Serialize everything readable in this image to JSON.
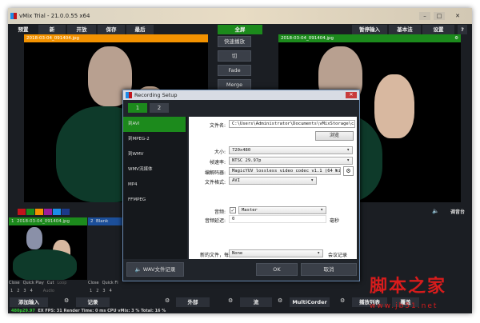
{
  "window": {
    "title": "vMix Trial - 21.0.0.55 x64",
    "min": "–",
    "max": "□",
    "close": "✕"
  },
  "menu": {
    "presets": "预置",
    "new": "新",
    "open": "开放",
    "save": "保存",
    "last": "最后",
    "fullscreen": "全屏",
    "add_input_stream": "暂停输入",
    "basic": "基本法",
    "settings": "设置",
    "help": "?"
  },
  "preview": {
    "title": "2018-03-04_091404.jpg"
  },
  "output": {
    "title": "2018-03-04_091404.jpg"
  },
  "transitions": {
    "quick_play": "快速播放",
    "cut": "切",
    "fade": "Fade",
    "merge": "Merge"
  },
  "colors": {
    "accent_green": "#1c8a1c",
    "preview_orange": "#f39200",
    "input_blue": "#1c4f9a",
    "tags": [
      "#c0141c",
      "#1c8a1c",
      "#f39200",
      "#9b1c9b",
      "#1c8ce8",
      "#1c3a8a"
    ]
  },
  "inputs": [
    {
      "number": "1",
      "name": "2018-03-04_091404.jpg",
      "controls": [
        "Close",
        "Quick Play",
        "Cut",
        "Loop"
      ],
      "numbers": [
        "1",
        "2",
        "3",
        "4"
      ],
      "audio": "Audio"
    },
    {
      "number": "2",
      "name": "Blank",
      "controls": [
        "Close",
        "Quick Fl"
      ],
      "numbers": [
        "1",
        "2",
        "3",
        "4"
      ],
      "audio": "Audio"
    }
  ],
  "mixer_label": "调音台",
  "dialog": {
    "title": "Recording Setup",
    "tabs": [
      "1",
      "2"
    ],
    "formats": [
      "到AVI",
      "到MPEG-2",
      "到WMV",
      "WMV流媒体",
      "MP4",
      "FFMPEG"
    ],
    "filename_label": "文件名:",
    "filename": "C:\\Users\\Administrator\\Documents\\vMixStorage\\capture.av",
    "browse": "浏览",
    "size_label": "大小:",
    "size": "720x480",
    "framerate_label": "帧速率:",
    "framerate": "NTSC 29.97p",
    "codec_label": "编解码器:",
    "codec": "MagicYUV lossless video codec v1.1 (64 bit)",
    "format_label": "文件格式:",
    "format": "AVI",
    "audio_label": "音频:",
    "audio": "Master",
    "audio_checked": true,
    "delay_label": "音频延迟:",
    "delay": "0",
    "delay_unit": "毫秒",
    "newfile_label": "新的文件，每",
    "newfile": "None",
    "newfile_suffix": "会议记录",
    "wav": "WAV文件记录",
    "ok": "OK",
    "cancel": "取消"
  },
  "bottom": {
    "add_input": "添加输入",
    "record": "记录",
    "external": "外部",
    "stream": "流",
    "multicorder": "MultiCorder",
    "playlist": "播放列表",
    "overlay": "覆盖"
  },
  "status": {
    "format": "480p29.97",
    "ex_fps_label": "EX FPS:",
    "ex_fps": "31",
    "render_label": "Render Time:",
    "render": "0 ms",
    "cpu_label": "CPU vMix:",
    "cpu": "3 %",
    "total_label": "Total:",
    "total": "16 %"
  },
  "watermark": {
    "text": "脚本之家",
    "url": "www.jb51.net"
  }
}
